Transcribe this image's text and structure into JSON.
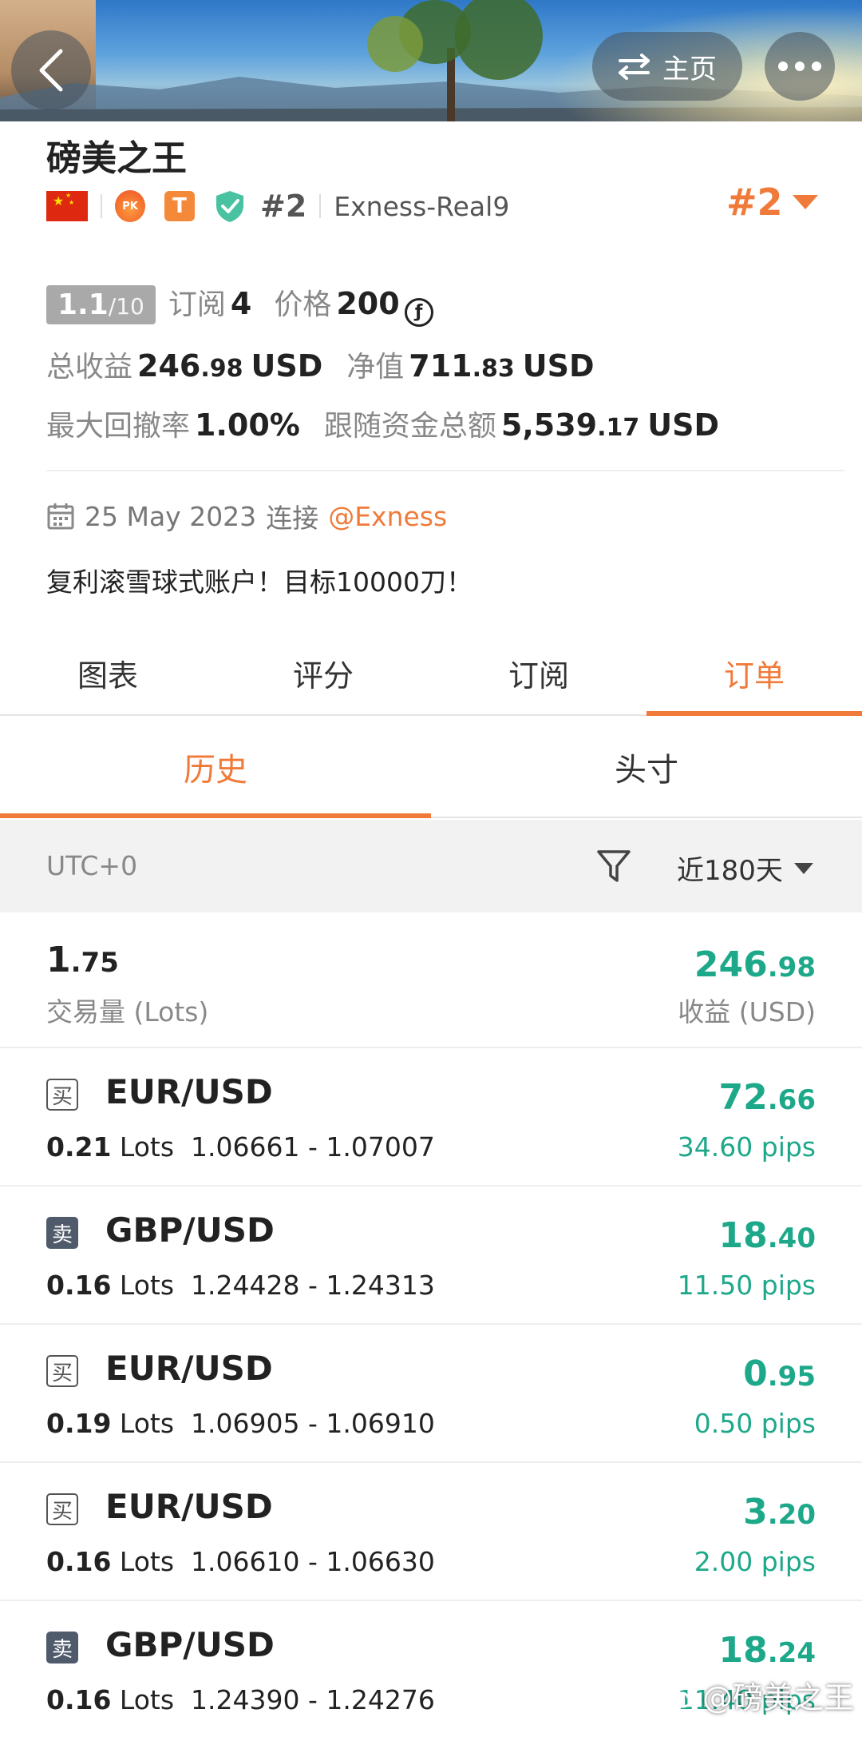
{
  "header": {
    "home_label": "主页",
    "icons": [
      "back-icon",
      "swap-icon",
      "more-icon"
    ]
  },
  "profile": {
    "name": "磅美之王",
    "flag": "China",
    "rank_small": "#2",
    "separator": "|",
    "server": "Exness-Real9",
    "rank_big": "#2",
    "icons": [
      "china-flag-icon",
      "pk-badge-icon",
      "t-badge-icon",
      "verified-shield-icon",
      "rank-dropdown-icon"
    ]
  },
  "stats": {
    "score_main": "1.1",
    "score_denominator": "/10",
    "subscribe_label": "订阅",
    "subscribe_count": "4",
    "price_label": "价格",
    "price_value": "200",
    "price_icon_glyph": "ƒ",
    "total_profit_label": "总收益",
    "total_profit_int": "246",
    "total_profit_dec": ".98",
    "total_profit_unit": "USD",
    "equity_label": "净值",
    "equity_int": "711",
    "equity_dec": ".83",
    "equity_unit": "USD",
    "max_drawdown_label": "最大回撤率",
    "max_drawdown_value": "1.00%",
    "follow_funds_label": "跟随资金总额",
    "follow_funds_int": "5,539",
    "follow_funds_dec": ".17",
    "follow_funds_unit": "USD"
  },
  "joined": {
    "date": "25 May 2023",
    "text": "连接",
    "broker": "@Exness"
  },
  "motto": "复利滚雪球式账户！目标10000刀！",
  "main_tabs": [
    {
      "label": "图表",
      "active": false
    },
    {
      "label": "评分",
      "active": false
    },
    {
      "label": "订阅",
      "active": false
    },
    {
      "label": "订单",
      "active": true
    }
  ],
  "sub_tabs": [
    {
      "label": "历史",
      "active": true
    },
    {
      "label": "头寸",
      "active": false
    }
  ],
  "filter": {
    "timezone": "UTC+0",
    "period": "近180天"
  },
  "summary": {
    "lots_int": "1",
    "lots_dec": ".75",
    "lots_label": "交易量 (Lots)",
    "profit_int": "246",
    "profit_dec": ".98",
    "profit_label": "收益 (USD)"
  },
  "orders": [
    {
      "side": "买",
      "type": "buy",
      "symbol": "EUR/USD",
      "lots": "0.21",
      "lots_unit": "Lots",
      "prices": "1.06661 - 1.07007",
      "profit_int": "72",
      "profit_dec": ".66",
      "pips": "34.60 pips"
    },
    {
      "side": "卖",
      "type": "sell",
      "symbol": "GBP/USD",
      "lots": "0.16",
      "lots_unit": "Lots",
      "prices": "1.24428 - 1.24313",
      "profit_int": "18",
      "profit_dec": ".40",
      "pips": "11.50 pips"
    },
    {
      "side": "买",
      "type": "buy",
      "symbol": "EUR/USD",
      "lots": "0.19",
      "lots_unit": "Lots",
      "prices": "1.06905 - 1.06910",
      "profit_int": "0",
      "profit_dec": ".95",
      "pips": "0.50 pips"
    },
    {
      "side": "买",
      "type": "buy",
      "symbol": "EUR/USD",
      "lots": "0.16",
      "lots_unit": "Lots",
      "prices": "1.06610 - 1.06630",
      "profit_int": "3",
      "profit_dec": ".20",
      "pips": "2.00 pips"
    },
    {
      "side": "卖",
      "type": "sell",
      "symbol": "GBP/USD",
      "lots": "0.16",
      "lots_unit": "Lots",
      "prices": "1.24390 - 1.24276",
      "profit_int": "18",
      "profit_dec": ".24",
      "pips": "11.40 pips"
    }
  ],
  "watermark": "@磅美之王",
  "colors": {
    "accent": "#f07a3a",
    "profit": "#1ea88a",
    "muted": "#888888",
    "filter_bg": "#f2f2f2"
  }
}
